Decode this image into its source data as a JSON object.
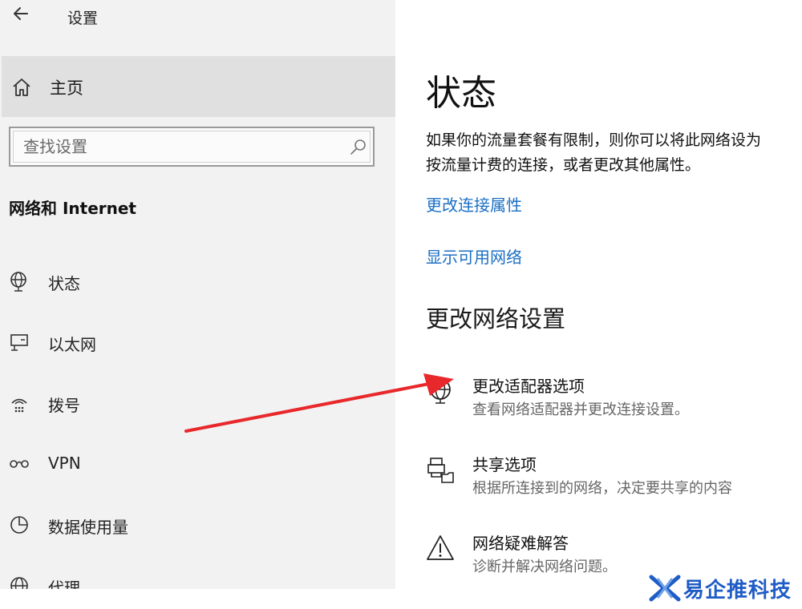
{
  "window": {
    "title": "设置"
  },
  "sidebar": {
    "home_label": "主页",
    "search_placeholder": "查找设置",
    "section_title": "网络和 Internet",
    "items": [
      {
        "label": "状态",
        "icon": "globe-network-icon"
      },
      {
        "label": "以太网",
        "icon": "ethernet-icon"
      },
      {
        "label": "拨号",
        "icon": "dialup-icon"
      },
      {
        "label": "VPN",
        "icon": "vpn-icon"
      },
      {
        "label": "数据使用量",
        "icon": "data-usage-icon"
      },
      {
        "label": "代理",
        "icon": "proxy-globe-icon"
      }
    ]
  },
  "main": {
    "title": "状态",
    "description": "如果你的流量套餐有限制，则你可以将此网络设为按流量计费的连接，或者更改其他属性。",
    "links": {
      "change_connection": "更改连接属性",
      "show_networks": "显示可用网络"
    },
    "section_title": "更改网络设置",
    "options": [
      {
        "title": "更改适配器选项",
        "desc": "查看网络适配器并更改连接设置。",
        "icon": "adapter-globe-icon"
      },
      {
        "title": "共享选项",
        "desc": "根据所连接到的网络，决定要共享的内容",
        "icon": "sharing-icon"
      },
      {
        "title": "网络疑难解答",
        "desc": "诊断并解决网络问题。",
        "icon": "warning-icon"
      }
    ]
  },
  "watermark": {
    "text": "易企推科技"
  },
  "colors": {
    "link": "#1b6fc4",
    "arrow": "#e8282b",
    "sidebar_bg": "#f2f2f2",
    "watermark": "#1f5cc6"
  }
}
